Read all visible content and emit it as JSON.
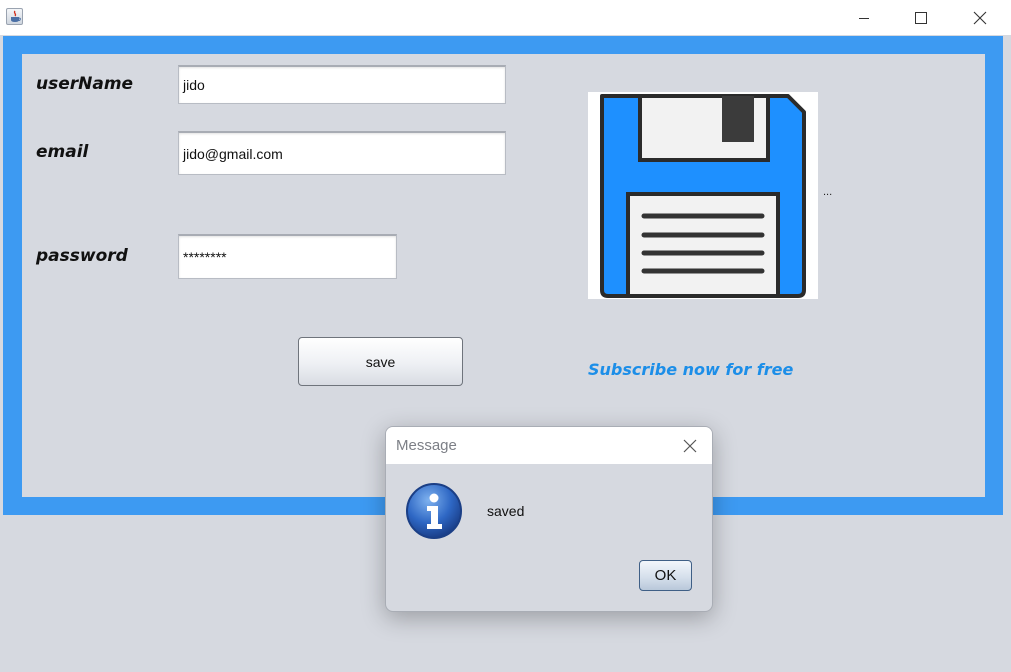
{
  "window": {
    "controls": {
      "minimize_icon": "minimize-icon",
      "maximize_icon": "maximize-icon",
      "close_icon": "close-icon"
    }
  },
  "form": {
    "username_label": "userName",
    "username_value": "jido",
    "email_label": "email",
    "email_value": "jido@gmail.com",
    "password_label": "password",
    "password_value": "********",
    "save_label": "save",
    "image_caption": "...",
    "subscribe_text": "Subscribe now for free"
  },
  "dialog": {
    "title": "Message",
    "message": "saved",
    "ok_label": "OK",
    "icon": "info-icon"
  },
  "colors": {
    "frame_border": "#3d9af2",
    "panel_bg": "#d6d9e0",
    "accent_text": "#1c8ee8",
    "floppy_blue": "#1e90ff"
  }
}
